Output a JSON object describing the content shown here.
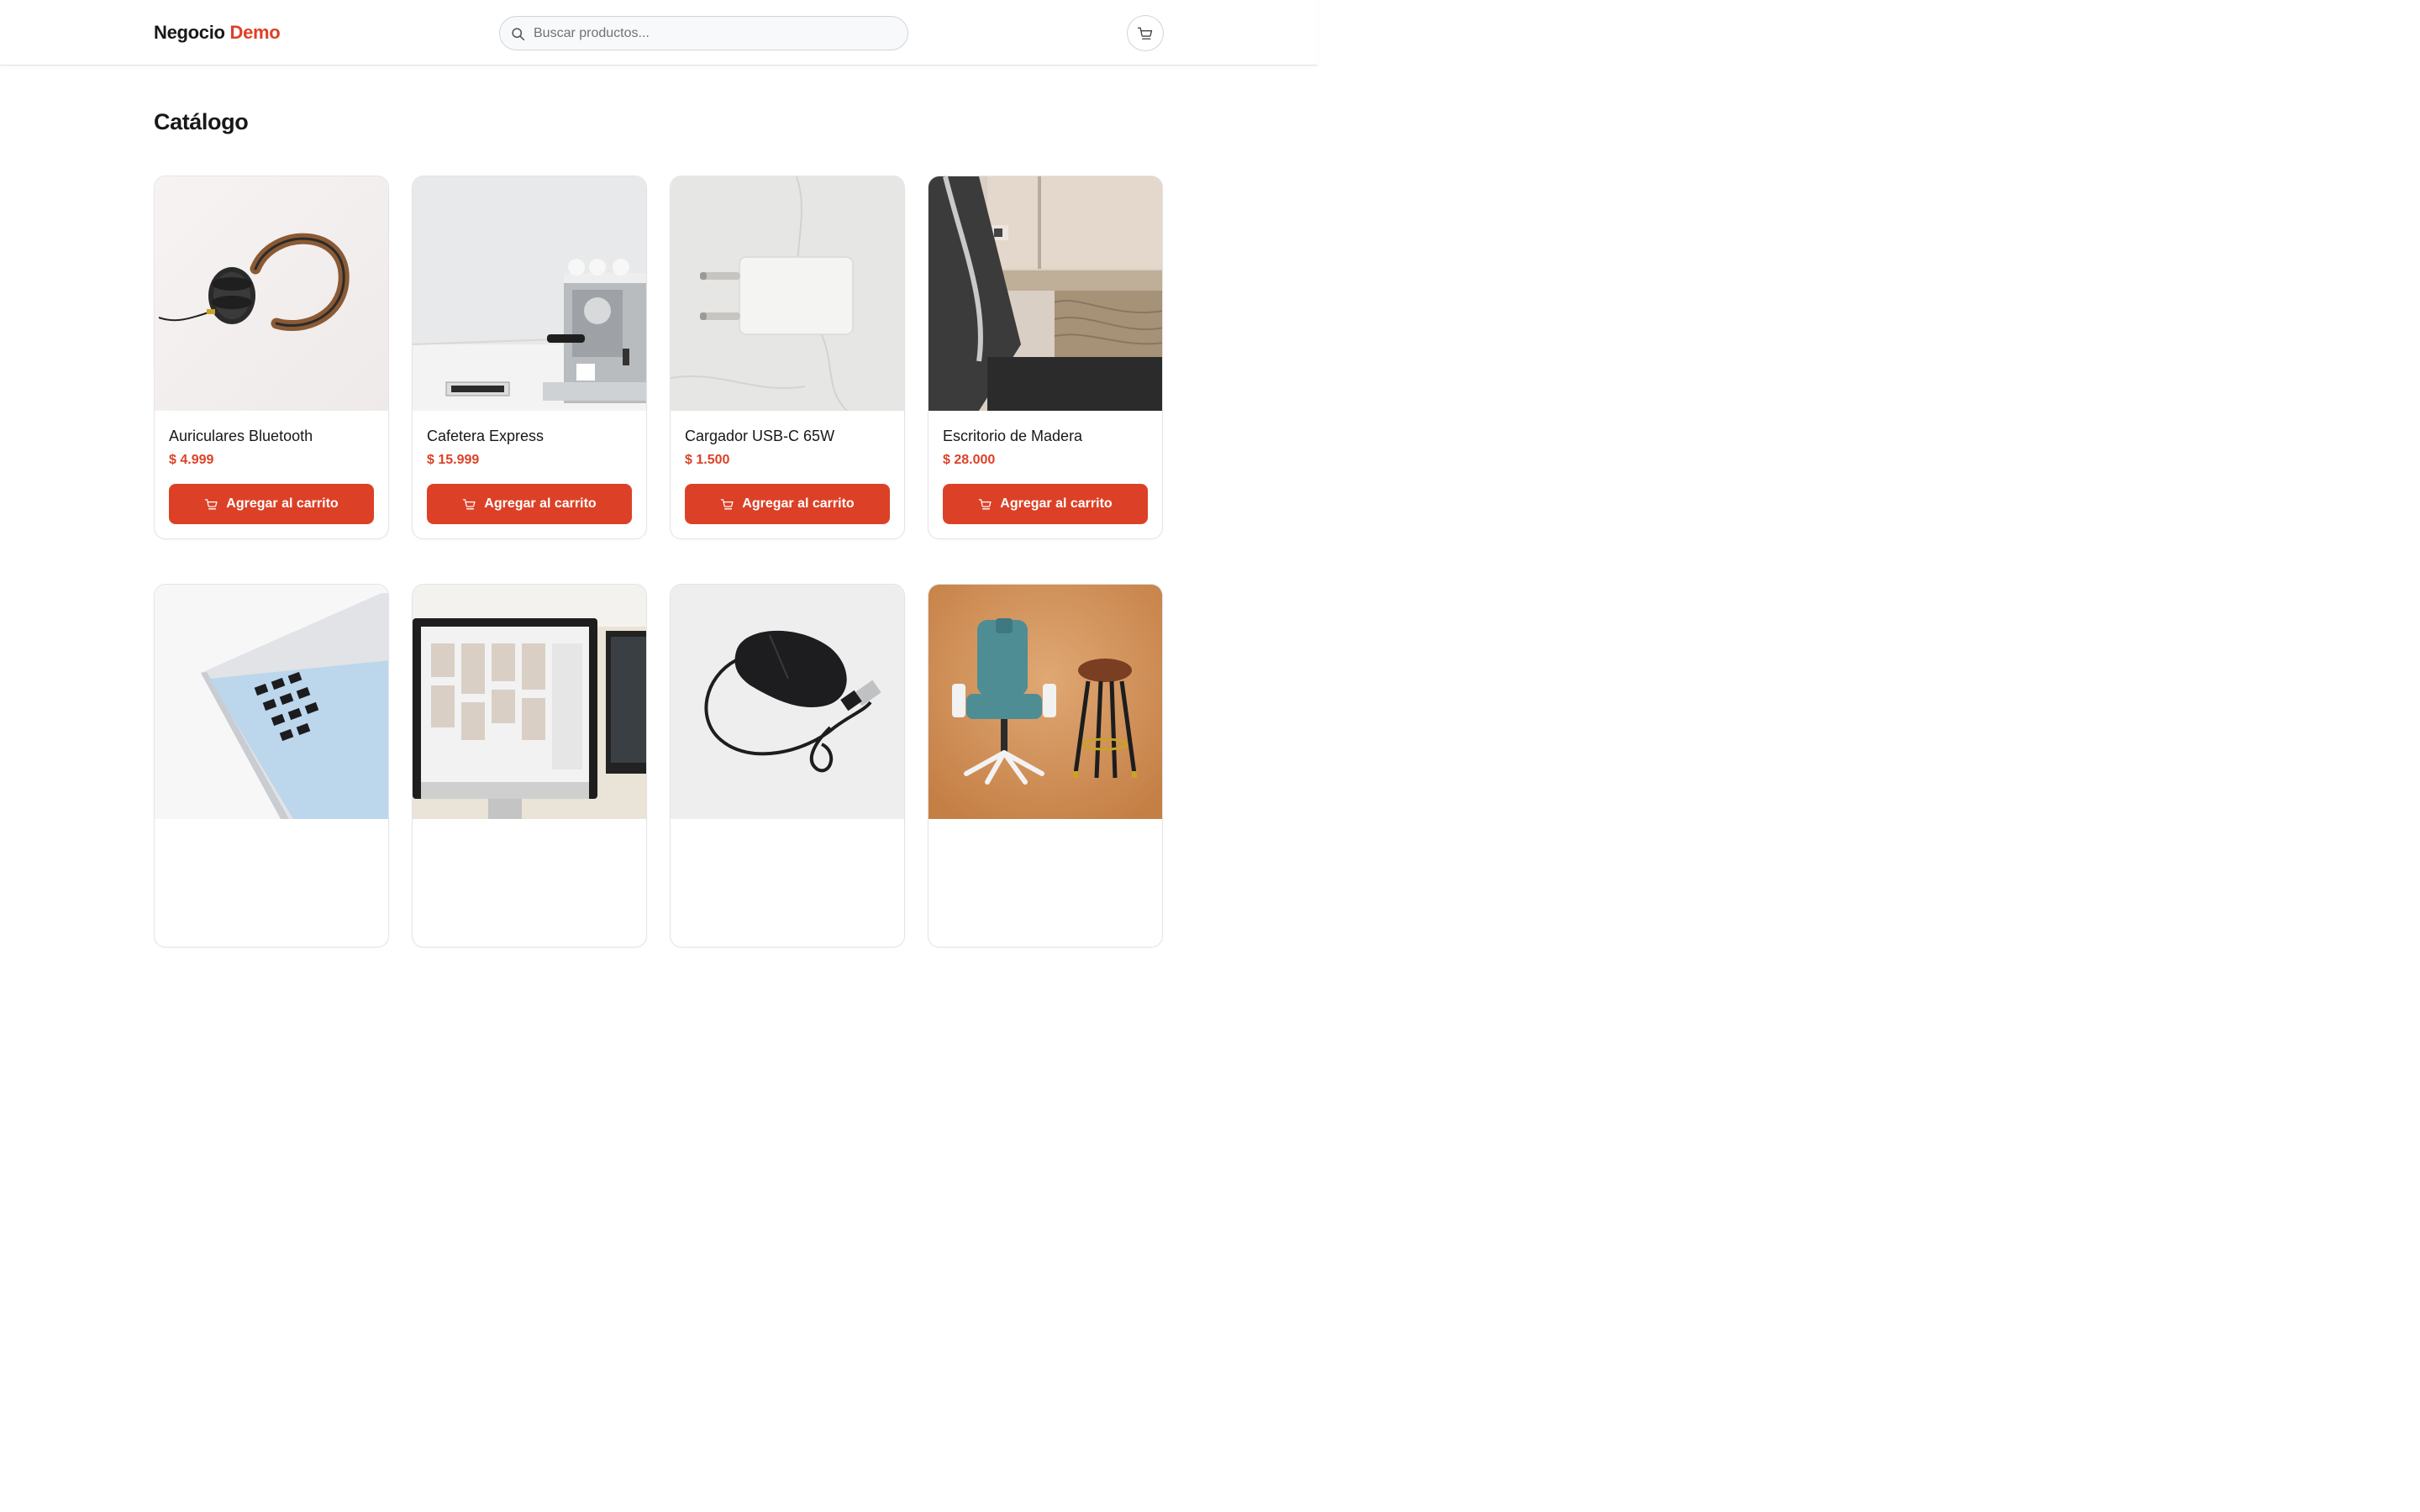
{
  "header": {
    "brand_main": "Negocio",
    "brand_accent": "Demo",
    "search_placeholder": "Buscar productos...",
    "cart_icon": "cart-icon"
  },
  "main": {
    "title": "Catálogo",
    "add_to_cart_label": "Agregar al carrito",
    "products": [
      {
        "name": "Auriculares Bluetooth",
        "price": "$ 4.999"
      },
      {
        "name": "Cafetera Express",
        "price": "$ 15.999"
      },
      {
        "name": "Cargador USB-C 65W",
        "price": "$ 1.500"
      },
      {
        "name": "Escritorio de Madera",
        "price": "$ 28.000"
      },
      {
        "name": "",
        "price": ""
      },
      {
        "name": "",
        "price": ""
      },
      {
        "name": "",
        "price": ""
      },
      {
        "name": "",
        "price": ""
      }
    ]
  },
  "colors": {
    "accent": "#dc4127",
    "text": "#18181b",
    "border": "#e4e4e7"
  }
}
